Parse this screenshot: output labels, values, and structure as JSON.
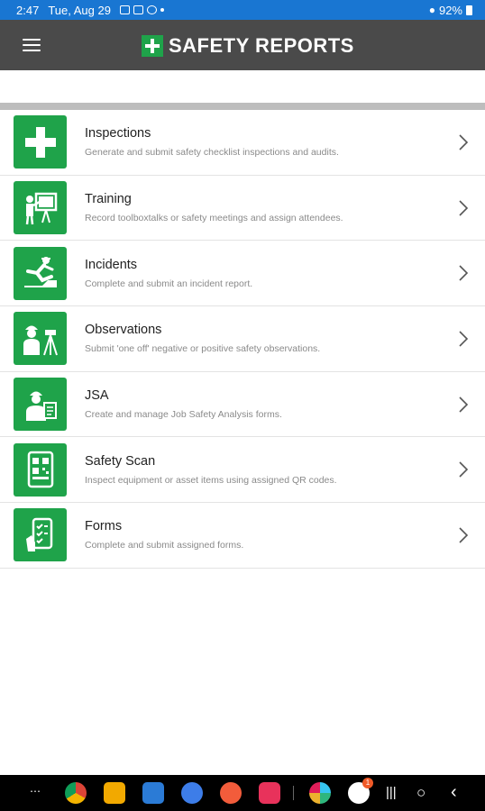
{
  "status": {
    "time": "2:47",
    "date": "Tue, Aug 29",
    "battery": "92%"
  },
  "header": {
    "title": "SAFETY REPORTS",
    "menu_icon": "hamburger-menu-icon"
  },
  "items": [
    {
      "title": "Inspections",
      "desc": "Generate and submit safety checklist inspections and audits.",
      "icon": "plus-cross-icon"
    },
    {
      "title": "Training",
      "desc": "Record toolboxtalks or safety meetings and assign attendees.",
      "icon": "presenter-board-icon"
    },
    {
      "title": "Incidents",
      "desc": "Complete and submit an incident report.",
      "icon": "worker-fall-icon"
    },
    {
      "title": "Observations",
      "desc": "Submit 'one off' negative or positive safety observations.",
      "icon": "surveyor-tripod-icon"
    },
    {
      "title": "JSA",
      "desc": "Create and manage Job Safety Analysis forms.",
      "icon": "worker-clipboard-icon"
    },
    {
      "title": "Safety Scan",
      "desc": "Inspect equipment or asset items using assigned QR codes.",
      "icon": "qr-tablet-icon"
    },
    {
      "title": "Forms",
      "desc": "Complete and submit assigned forms.",
      "icon": "checklist-phone-icon"
    }
  ],
  "navbar": {
    "play_store_badge": "1"
  },
  "colors": {
    "accent": "#1fa34a",
    "topbar": "#4a4a4a",
    "statusbar": "#1976d2"
  }
}
